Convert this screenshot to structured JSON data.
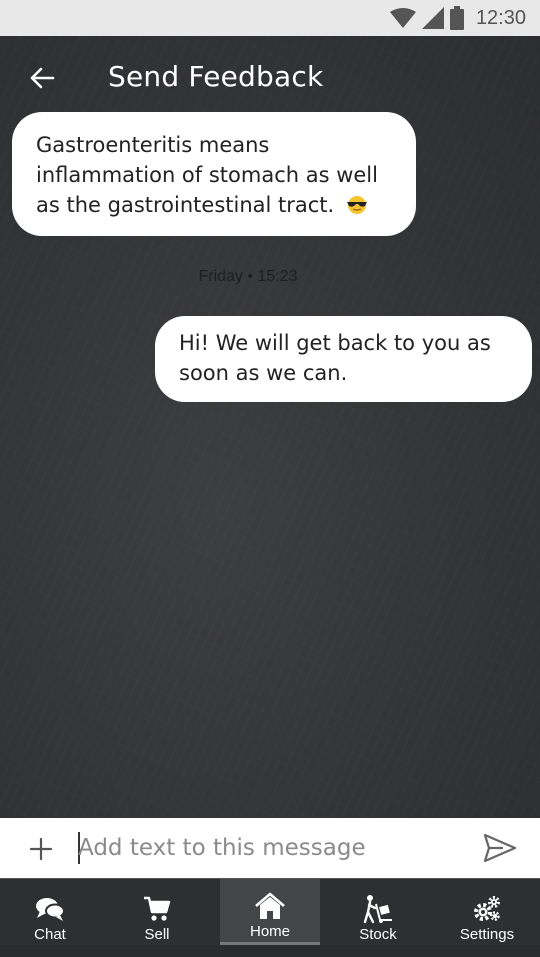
{
  "status_bar": {
    "time": "12:30"
  },
  "header": {
    "title": "Send Feedback"
  },
  "messages": [
    {
      "side": "received",
      "text": "Gastroenteritis means inflammation of stomach as well as the gastrointestinal tract.",
      "emoji": "sunglasses-emoji"
    },
    {
      "side": "sent",
      "text": "Hi! We will get back to you as soon as we can."
    }
  ],
  "timestamp": "Friday • 15:23",
  "composer": {
    "placeholder": "Add text to this message",
    "value": ""
  },
  "nav": {
    "items": [
      {
        "label": "Chat",
        "icon": "chat-icon"
      },
      {
        "label": "Sell",
        "icon": "cart-icon"
      },
      {
        "label": "Home",
        "icon": "home-icon",
        "active": true
      },
      {
        "label": "Stock",
        "icon": "hand-truck-icon"
      },
      {
        "label": "Settings",
        "icon": "gears-icon"
      }
    ]
  },
  "colors": {
    "background": "#333436",
    "bubble": "#ffffff",
    "nav": "#2e2f30",
    "status_bar": "#e8e8e8"
  }
}
